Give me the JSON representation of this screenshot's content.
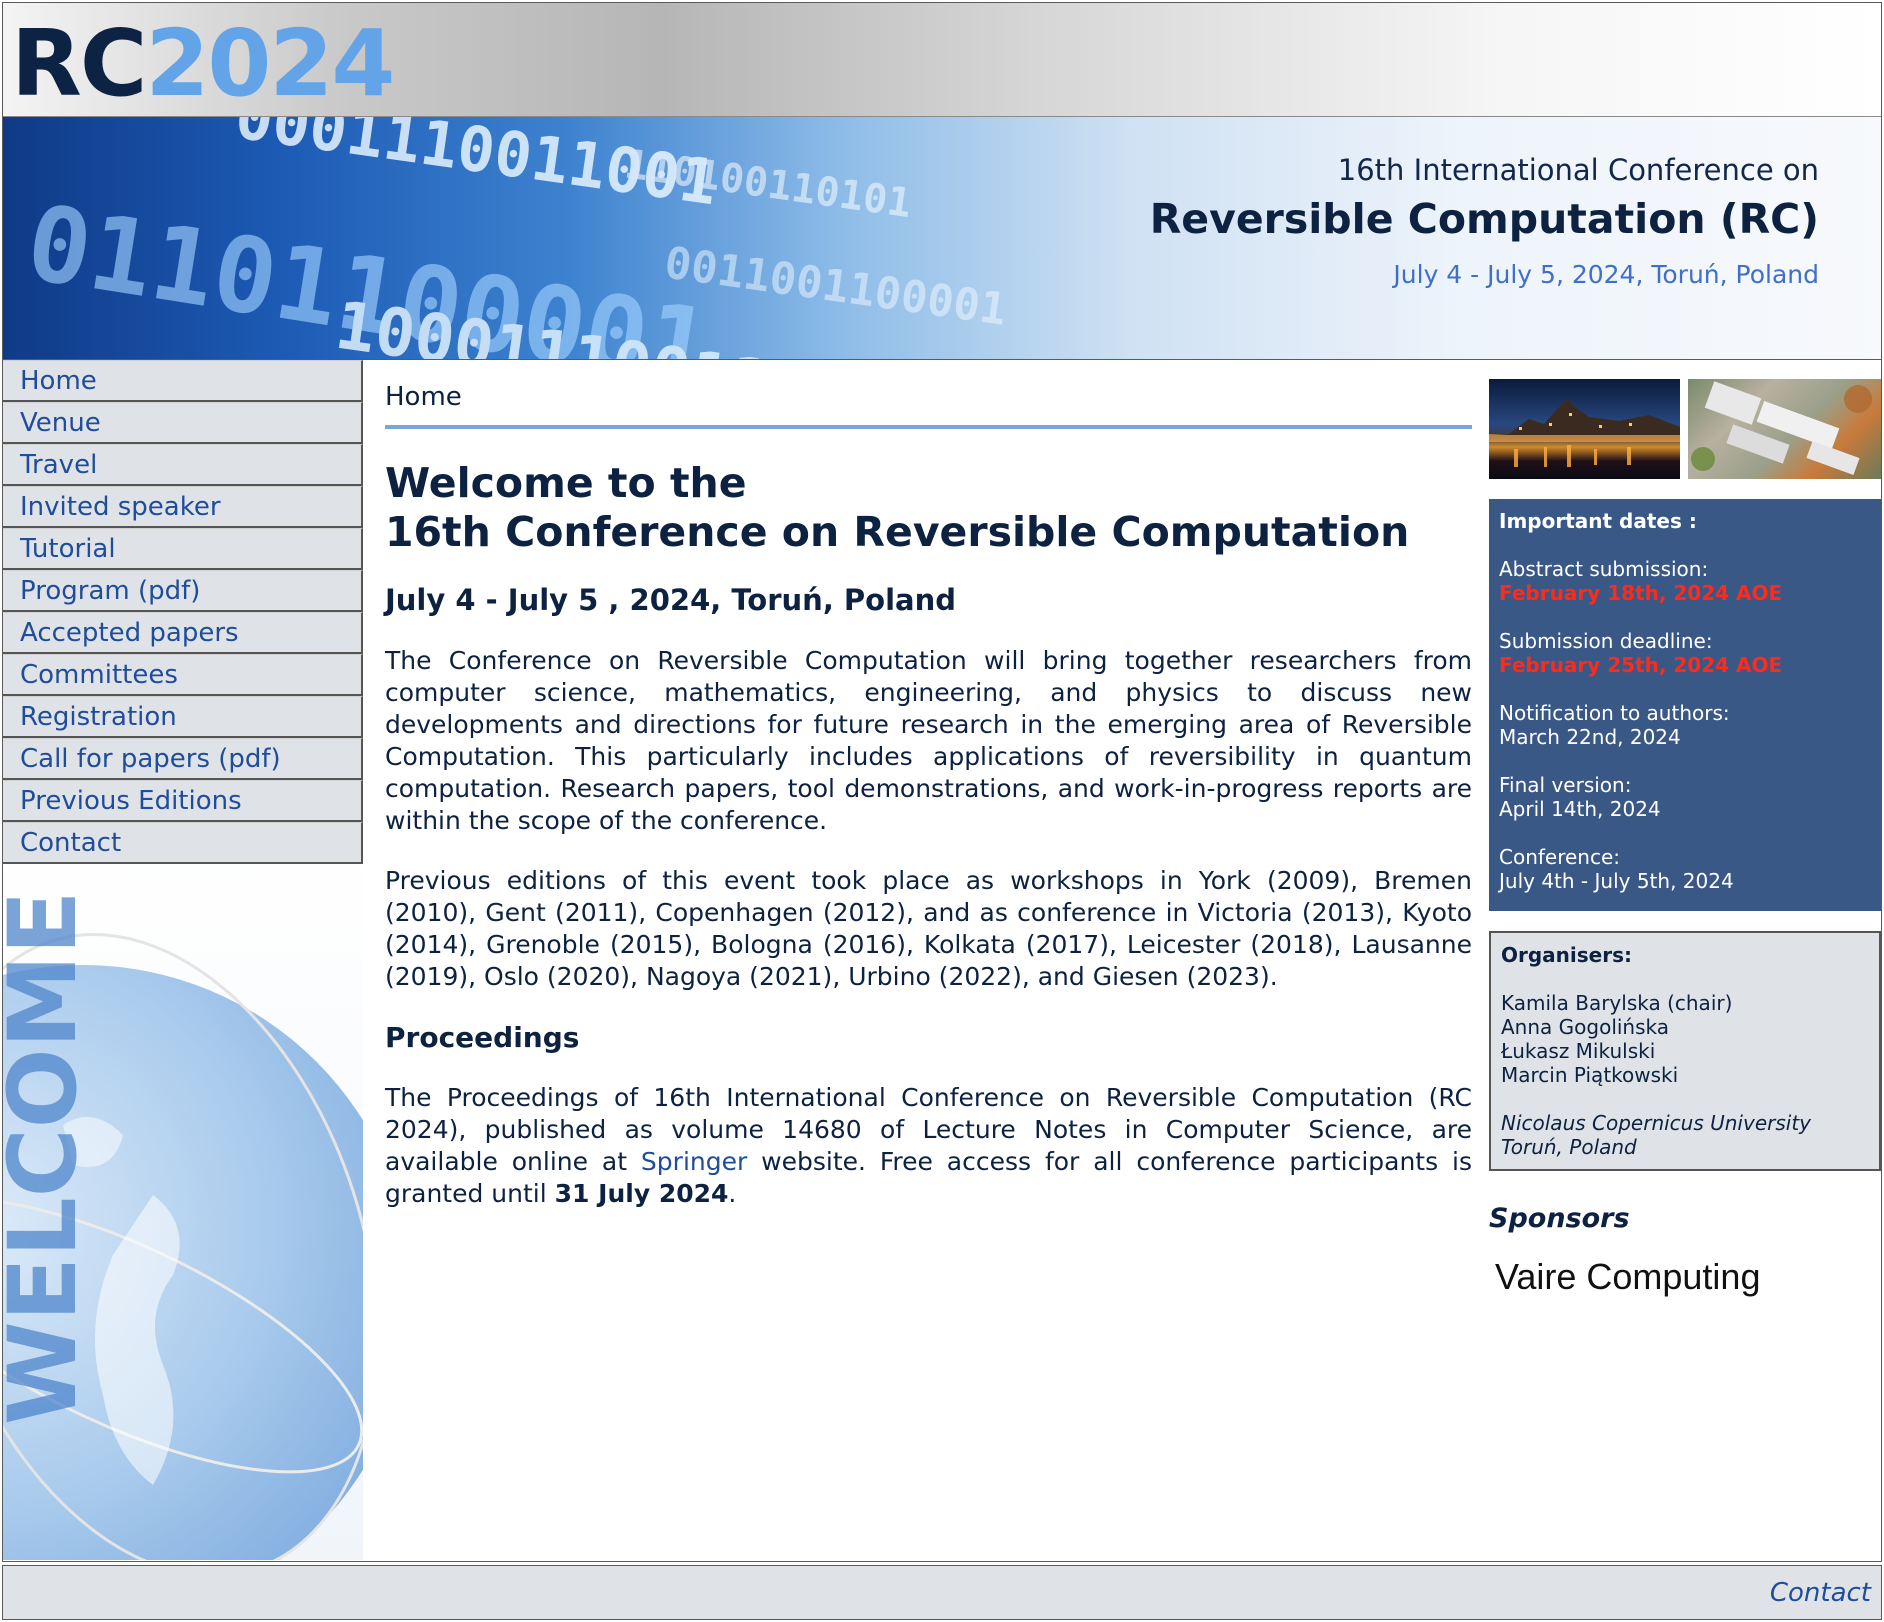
{
  "logo": {
    "prefix": "RC",
    "year": "2024"
  },
  "banner": {
    "subtitle": "16th International Conference on",
    "title": "Reversible Computation (RC)",
    "dates": "July 4 - July 5, 2024, Toruń, Poland"
  },
  "nav": {
    "items": [
      {
        "label": "Home"
      },
      {
        "label": "Venue"
      },
      {
        "label": "Travel"
      },
      {
        "label": "Invited speaker"
      },
      {
        "label": "Tutorial"
      },
      {
        "label": "Program (pdf)"
      },
      {
        "label": "Accepted papers"
      },
      {
        "label": "Committees"
      },
      {
        "label": "Registration"
      },
      {
        "label": "Call for papers (pdf)"
      },
      {
        "label": "Previous Editions"
      },
      {
        "label": "Contact"
      }
    ]
  },
  "main": {
    "breadcrumb": "Home",
    "heading_line1": "Welcome to the",
    "heading_line2": "16th Conference on Reversible Computation",
    "dates": "July 4 - July 5 , 2024, Toruń, Poland",
    "intro": "The Conference on Reversible Computation will bring together researchers from computer science, mathematics, engineering, and physics to discuss new developments and directions for future research in the emerging area of Reversible Computation. This particularly includes applications of reversibility in quantum computation. Research papers, tool demonstrations, and work-in-progress reports are within the scope of the conference.",
    "previous": "Previous editions of this event took place as workshops in York (2009), Bremen (2010), Gent (2011), Copenhagen (2012), and as conference in Victoria (2013), Kyoto (2014), Grenoble (2015), Bologna (2016), Kolkata (2017), Leicester (2018), Lausanne (2019), Oslo (2020), Nagoya (2021), Urbino (2022), and Giesen (2023).",
    "proceedings_heading": "Proceedings",
    "proceedings_before": "The Proceedings of 16th International Conference on Reversible Computation (RC 2024), published as volume 14680 of Lecture Notes in Computer Science, are available online at ",
    "proceedings_link": "Springer",
    "proceedings_middle": " website. Free access for all conference participants is granted until ",
    "proceedings_date": "31 July 2024",
    "proceedings_end": "."
  },
  "important_dates": {
    "heading": "Important dates :",
    "items": [
      {
        "label": "Abstract submission:",
        "value": "February 18th, 2024 AOE"
      },
      {
        "label": "Submission deadline:",
        "value": "February 25th, 2024 AOE"
      },
      {
        "label": "Notification to authors:",
        "value": "March 22nd, 2024"
      },
      {
        "label": "Final version:",
        "value": "April 14th, 2024"
      },
      {
        "label": "Conference:",
        "value": "July 4th - July 5th, 2024"
      }
    ]
  },
  "organisers": {
    "heading": "Organisers:",
    "names": [
      "Kamila Barylska (chair)",
      "Anna Gogolińska",
      "Łukasz Mikulski",
      "Marcin Piątkowski"
    ],
    "affiliation_line1": "Nicolaus Copernicus University",
    "affiliation_line2": "Toruń, Poland"
  },
  "sponsors": {
    "heading": "Sponsors",
    "logo_text": "Vaire Computing"
  },
  "banner_watermark": "WELCOME",
  "footer": {
    "contact": "Contact"
  },
  "colors": {
    "navy": "#0d2140",
    "accent_blue": "#63a3e8",
    "link": "#1f4d9a",
    "dates_box": "#3a5886",
    "deadline_red": "#ff2a1a"
  }
}
